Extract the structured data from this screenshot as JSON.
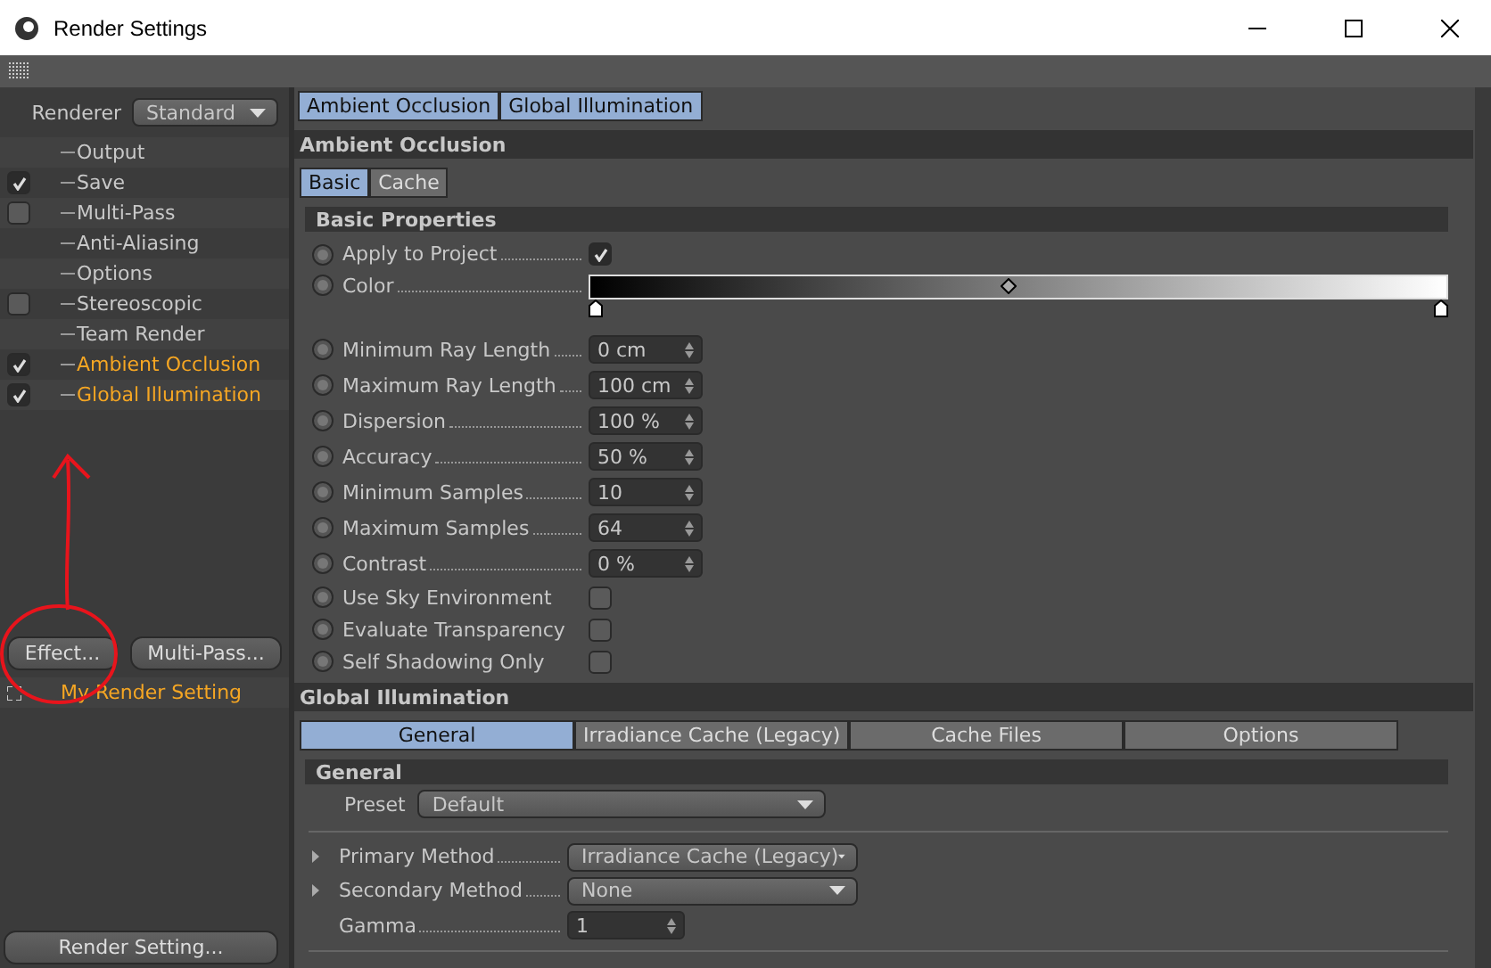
{
  "window": {
    "title": "Render Settings"
  },
  "renderer": {
    "label": "Renderer",
    "value": "Standard"
  },
  "settings_list": [
    {
      "label": "Output",
      "kind": "plain",
      "highlighted": false
    },
    {
      "label": "Save",
      "kind": "checkbox",
      "checked": true,
      "highlighted": false
    },
    {
      "label": "Multi-Pass",
      "kind": "checkbox",
      "checked": false,
      "highlighted": false
    },
    {
      "label": "Anti-Aliasing",
      "kind": "plain",
      "highlighted": false
    },
    {
      "label": "Options",
      "kind": "plain",
      "highlighted": false
    },
    {
      "label": "Stereoscopic",
      "kind": "checkbox",
      "checked": false,
      "highlighted": false
    },
    {
      "label": "Team Render",
      "kind": "plain",
      "highlighted": false
    },
    {
      "label": "Ambient Occlusion",
      "kind": "checkbox",
      "checked": true,
      "highlighted": true
    },
    {
      "label": "Global Illumination",
      "kind": "checkbox",
      "checked": true,
      "highlighted": true
    }
  ],
  "left_buttons": [
    "Effect...",
    "Multi-Pass..."
  ],
  "render_settings": [
    {
      "label": "My Render Setting"
    }
  ],
  "bottom_button": "Render Setting...",
  "top_tabs": [
    {
      "label": "Ambient Occlusion",
      "selected": true
    },
    {
      "label": "Global Illumination",
      "selected": true
    }
  ],
  "ambient_occlusion": {
    "title": "Ambient Occlusion",
    "tabs": [
      {
        "label": "Basic",
        "selected": true
      },
      {
        "label": "Cache",
        "selected": false
      }
    ],
    "group": "Basic Properties",
    "rows": [
      {
        "kind": "checkbox",
        "label": "Apply to Project",
        "checked": true
      },
      {
        "kind": "gradient",
        "label": "Color"
      },
      {
        "kind": "number",
        "label": "Minimum Ray Length",
        "value": "0 cm"
      },
      {
        "kind": "number",
        "label": "Maximum Ray Length",
        "value": "100 cm"
      },
      {
        "kind": "number",
        "label": "Dispersion",
        "value": "100 %"
      },
      {
        "kind": "number",
        "label": "Accuracy",
        "value": "50 %"
      },
      {
        "kind": "number",
        "label": "Minimum Samples",
        "value": "10"
      },
      {
        "kind": "number",
        "label": "Maximum Samples",
        "value": "64"
      },
      {
        "kind": "number",
        "label": "Contrast",
        "value": "0 %"
      },
      {
        "kind": "checkbox",
        "label": "Use Sky Environment",
        "checked": false
      },
      {
        "kind": "checkbox",
        "label": "Evaluate Transparency",
        "checked": false
      },
      {
        "kind": "checkbox",
        "label": "Self Shadowing Only",
        "checked": false
      }
    ]
  },
  "global_illumination": {
    "title": "Global Illumination",
    "tabs": [
      {
        "label": "General",
        "selected": true
      },
      {
        "label": "Irradiance Cache (Legacy)",
        "selected": false
      },
      {
        "label": "Cache Files",
        "selected": false
      },
      {
        "label": "Options",
        "selected": false
      }
    ],
    "group": "General",
    "preset": {
      "label": "Preset",
      "value": "Default"
    },
    "rows": [
      {
        "kind": "dropdown",
        "label": "Primary Method",
        "value": "Irradiance Cache (Legacy)"
      },
      {
        "kind": "dropdown",
        "label": "Secondary Method",
        "value": "None"
      },
      {
        "kind": "number",
        "label": "Gamma",
        "value": "1"
      }
    ]
  }
}
